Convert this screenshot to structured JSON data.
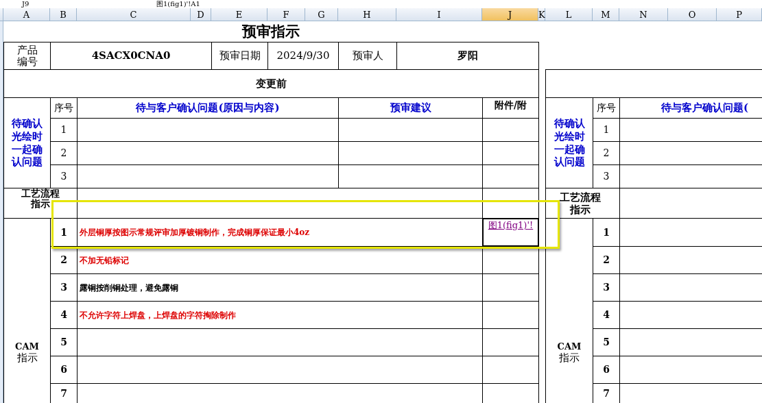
{
  "formula_bar": {
    "cell_ref": "J9",
    "formula": "图1(fig1)'!A1"
  },
  "columns": [
    {
      "label": "A",
      "selected": false
    },
    {
      "label": "B",
      "selected": false
    },
    {
      "label": "C",
      "selected": false
    },
    {
      "label": "D",
      "selected": false
    },
    {
      "label": "E",
      "selected": false
    },
    {
      "label": "F",
      "selected": false
    },
    {
      "label": "G",
      "selected": false
    },
    {
      "label": "H",
      "selected": false
    },
    {
      "label": "I",
      "selected": false
    },
    {
      "label": "J",
      "selected": true
    },
    {
      "label": "K",
      "selected": false
    },
    {
      "label": "L",
      "selected": false
    },
    {
      "label": "M",
      "selected": false
    },
    {
      "label": "N",
      "selected": false
    },
    {
      "label": "O",
      "selected": false
    },
    {
      "label": "P",
      "selected": false
    }
  ],
  "title": "预审指示",
  "info": {
    "product_label": "产品编号",
    "product_code": "4SACX0CNA0",
    "date_label": "预审日期",
    "date": "2024/9/30",
    "reviewer_label": "预审人",
    "reviewer": "罗阳"
  },
  "left_panel": {
    "section_title": "变更前",
    "confirm_label": "待确认光绘时一起确认问题",
    "headers": [
      "序号",
      "待与客户确认问题(原因与内容)",
      "预审建议",
      "附件/附"
    ],
    "confirm_rows": [
      "1",
      "2",
      "3"
    ],
    "process_label": "工艺流程指示",
    "cam_label_top": "CAM",
    "cam_label_bottom": "指示",
    "cam_rows": [
      {
        "no": "1",
        "text": "外层铜厚按图示常规评审加厚镀铜制作，完成铜厚保证最小4oz",
        "color": "#dd0000",
        "attachment": "图1(fig1)'!"
      },
      {
        "no": "2",
        "text": "不加无铅标记",
        "color": "#dd0000"
      },
      {
        "no": "3",
        "text": "露铜按削铜处理，避免露铜",
        "color": "#000000"
      },
      {
        "no": "4",
        "text": "不允许字符上焊盘，上焊盘的字符掏除制作",
        "color": "#dd0000"
      },
      {
        "no": "5"
      },
      {
        "no": "6"
      },
      {
        "no": "7"
      }
    ]
  },
  "right_panel": {
    "confirm_label": "待确认光绘时一起确认问题",
    "headers": [
      "序号",
      "待与客户确认问题("
    ],
    "confirm_rows": [
      "1",
      "2",
      "3"
    ],
    "process_label": "工艺流程指示",
    "cam_label_top": "CAM",
    "cam_label_bottom": "指示",
    "cam_rows": [
      "1",
      "2",
      "3",
      "4",
      "5",
      "6",
      "7"
    ]
  }
}
